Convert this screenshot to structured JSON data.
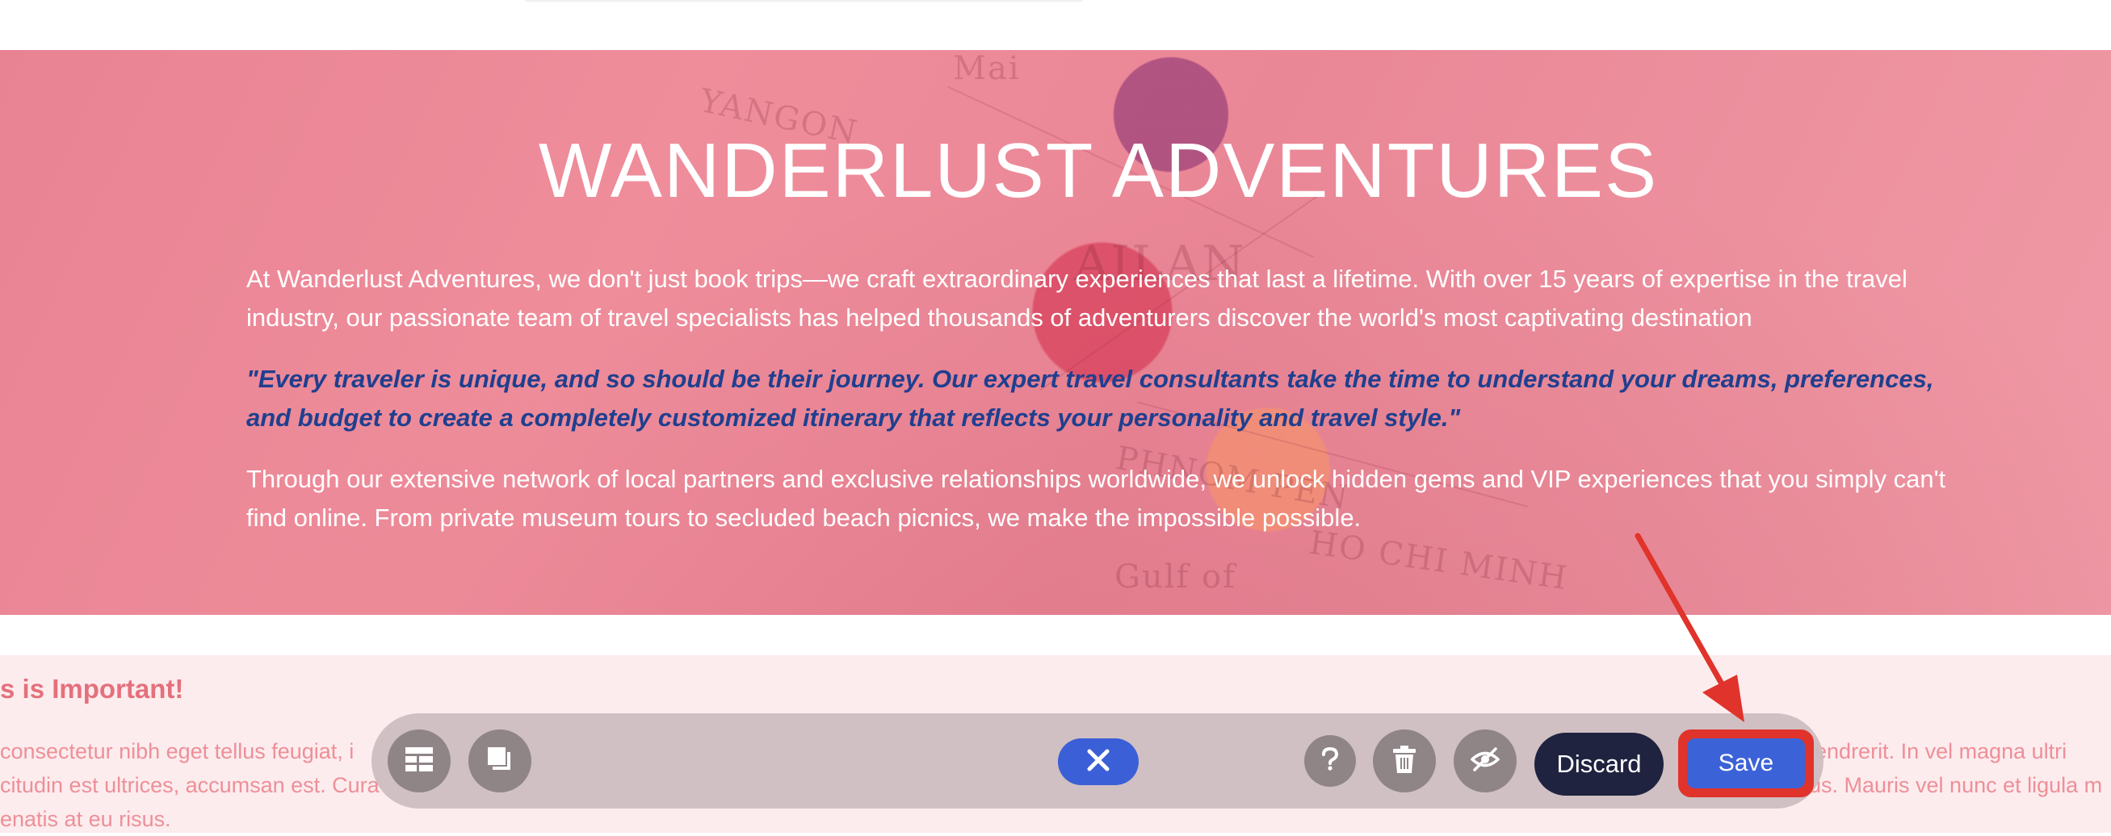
{
  "hero": {
    "title": "WANDERLUST ADVENTURES",
    "paragraph1": "At Wanderlust Adventures, we don't just book trips—we craft extraordinary experiences that last a lifetime. With over 15 years of expertise in the travel industry, our passionate team of travel specialists has helped thousands of adventurers discover the world's most captivating destination",
    "quote": "\"Every traveler is unique, and so should be their journey. Our expert travel consultants take the time to understand your dreams, preferences, and budget to create a completely customized itinerary that reflects your personality and travel style.\"",
    "paragraph3": "Through our extensive network of local partners and exclusive relationships worldwide, we unlock hidden gems and VIP experiences that you simply can't find online. From private museum tours to secluded beach picnics, we make the impossible possible.",
    "map_words": [
      "YANGON",
      "Mai",
      "AILAN",
      "PHNOM PEN",
      "Gulf of",
      "HO CHI MINH"
    ]
  },
  "section": {
    "heading": "s is Important!",
    "left_lines": [
      "consectetur nibh eget tellus feugiat, i",
      "citudin est ultrices, accumsan est. Cura",
      "enatis at eu risus."
    ],
    "right_lines": [
      "hendrerit. In vel magna ultri",
      "us. Mauris vel nunc et ligula m"
    ]
  },
  "toolbar": {
    "icons": [
      "layout-icon",
      "copy-icon",
      "close-icon",
      "help-icon",
      "trash-icon",
      "hide-icon"
    ],
    "discard_label": "Discard",
    "save_label": "Save"
  },
  "colors": {
    "accent_blue": "#3c62d8",
    "annotation_red": "#e0332b",
    "discard_navy": "#1f2340"
  }
}
